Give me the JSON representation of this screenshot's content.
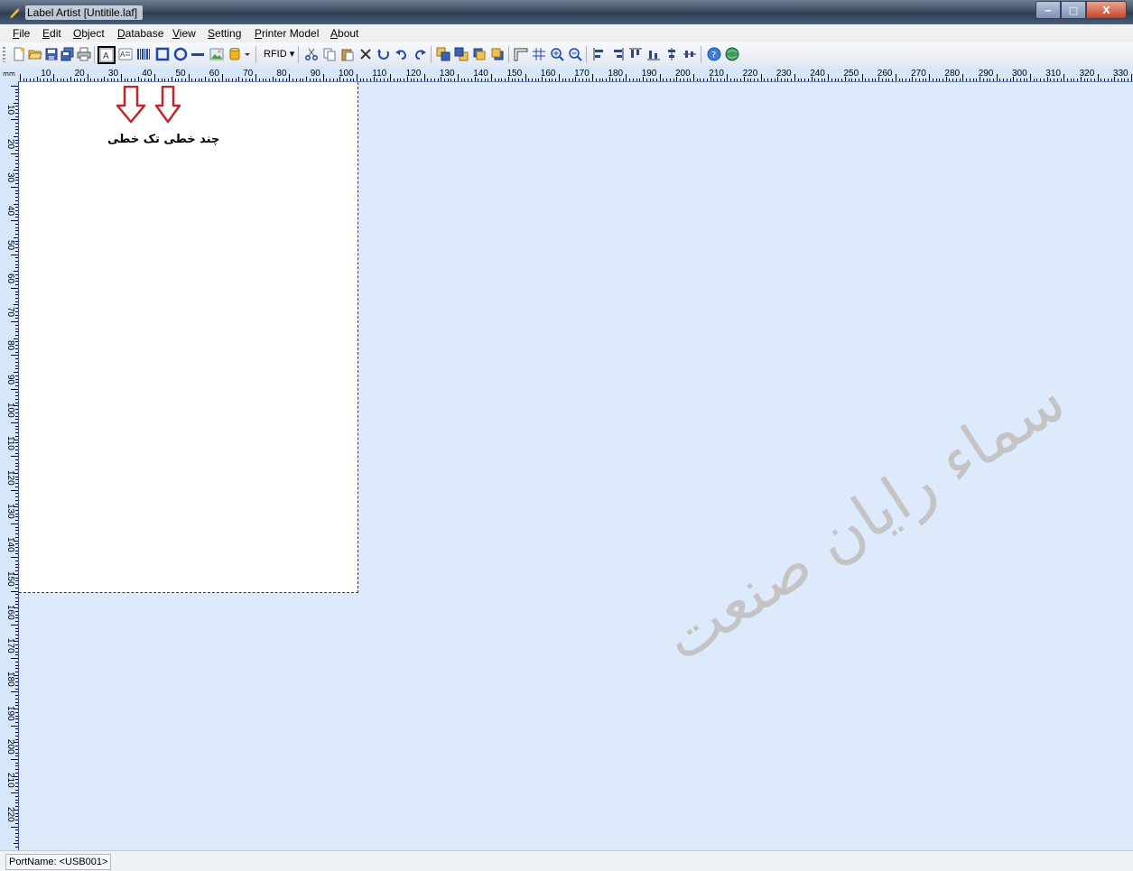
{
  "window": {
    "title": "Label Artist [Untitile.laf]",
    "minimize_glyph": "‒",
    "maximize_glyph": "□",
    "close_glyph": "X"
  },
  "menu": [
    "File",
    "Edit",
    "Object",
    "Database",
    "View",
    "Setting",
    "Printer Model",
    "About"
  ],
  "toolbar": {
    "rfid_label": "RFID",
    "icons": [
      "new-file-icon",
      "open-folder-icon",
      "save-icon",
      "save-all-icon",
      "print-icon",
      "text-icon",
      "multiline-text-icon",
      "barcode-icon",
      "rectangle-icon",
      "ellipse-icon",
      "line-icon",
      "image-icon",
      "database-icon",
      "dropdown-arrow-icon",
      "rfid-icon",
      "cut-icon",
      "copy-icon",
      "paste-icon",
      "delete-icon",
      "refresh-icon",
      "undo-icon",
      "redo-icon",
      "bring-front-icon",
      "send-back-icon",
      "bring-forward-icon",
      "send-backward-icon",
      "ruler-icon",
      "grid-icon",
      "zoom-in-icon",
      "zoom-out-icon",
      "align-left-icon",
      "align-right-icon",
      "align-top-icon",
      "align-bottom-icon",
      "center-vertical-icon",
      "center-horizontal-icon",
      "help-icon",
      "globe-icon"
    ]
  },
  "ruler": {
    "unit": "mm",
    "horizontal_labels": [
      "10",
      "20",
      "30",
      "40",
      "50",
      "60",
      "70",
      "80",
      "90",
      "100",
      "110",
      "120",
      "130",
      "140",
      "150",
      "160",
      "170",
      "180",
      "190",
      "200",
      "210",
      "220",
      "230",
      "240",
      "250",
      "260",
      "270",
      "280",
      "290",
      "300",
      "310",
      "320",
      "330"
    ],
    "vertical_labels": [
      "10",
      "20",
      "30",
      "40",
      "50",
      "60",
      "70",
      "80",
      "90",
      "100",
      "110",
      "120",
      "130",
      "140",
      "150",
      "160",
      "170",
      "180",
      "190",
      "200",
      "210",
      "220"
    ]
  },
  "annotation": {
    "text": "چند خطی  تک خطی",
    "arrow_color": "#c0272d"
  },
  "watermark": "سماء رایان صنعت",
  "status": {
    "port": "PortName: <USB001>"
  },
  "colors": {
    "workspace": "#dceafb",
    "ruler": "#d7e7fb",
    "canvas": "#ffffff"
  }
}
